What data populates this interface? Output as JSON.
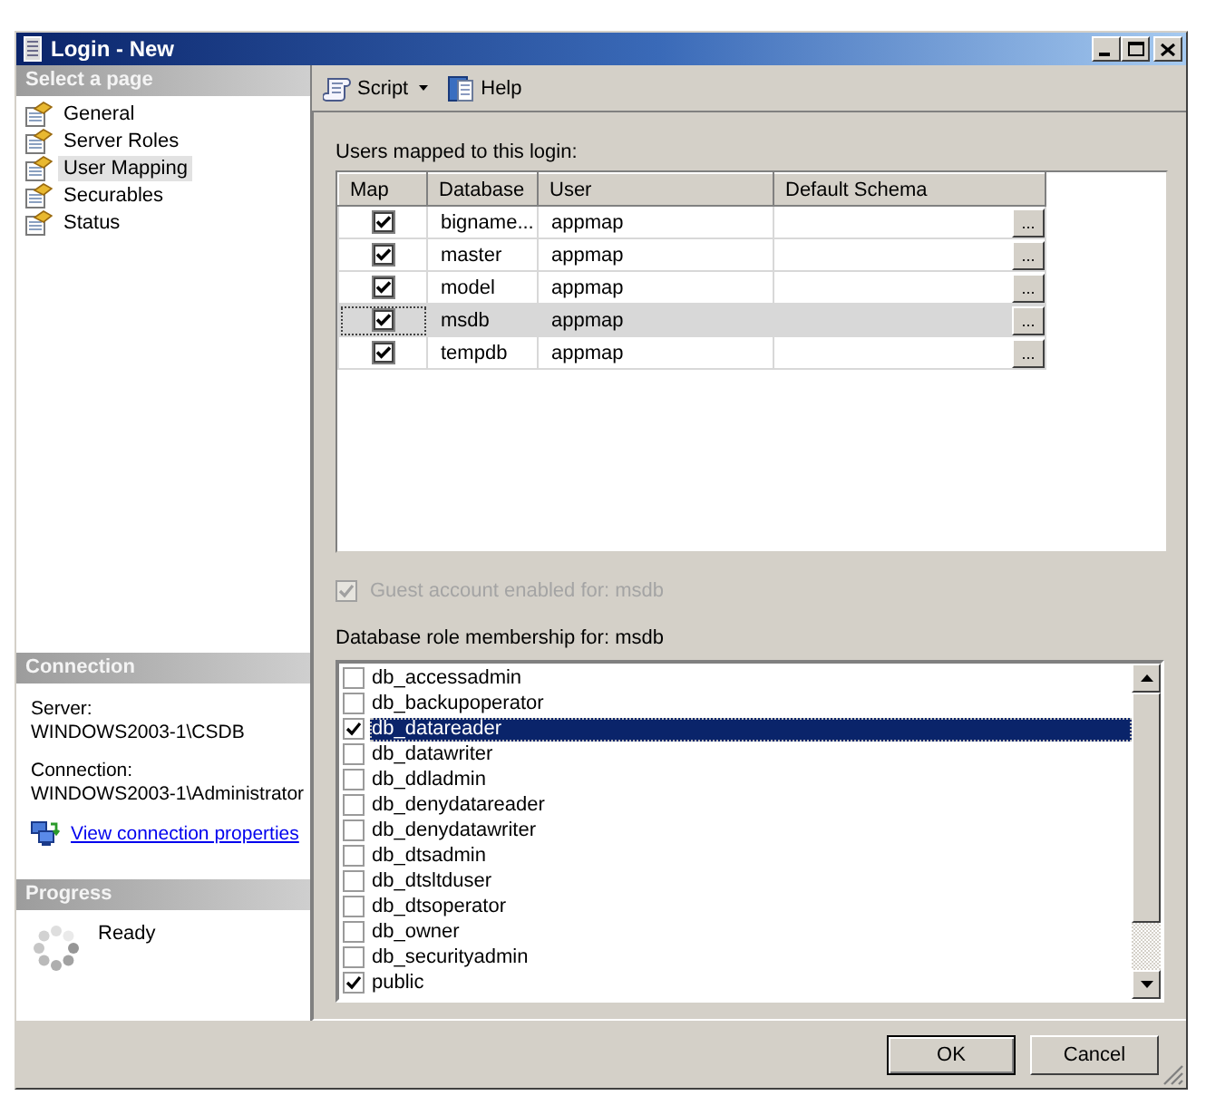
{
  "window": {
    "title": "Login - New"
  },
  "sidebar": {
    "header": "Select a page",
    "items": [
      {
        "label": "General",
        "selected": false
      },
      {
        "label": "Server Roles",
        "selected": false
      },
      {
        "label": "User Mapping",
        "selected": true
      },
      {
        "label": "Securables",
        "selected": false
      },
      {
        "label": "Status",
        "selected": false
      }
    ]
  },
  "connection": {
    "header": "Connection",
    "fields": [
      {
        "label": "Server:",
        "value": "WINDOWS2003-1\\CSDB"
      },
      {
        "label": "Connection:",
        "value": "WINDOWS2003-1\\Administrator"
      }
    ],
    "link": "View connection properties"
  },
  "progress": {
    "header": "Progress",
    "status": "Ready"
  },
  "toolbar": [
    {
      "kind": "script",
      "label": "Script",
      "dropdown": true
    },
    {
      "kind": "help",
      "label": "Help",
      "dropdown": false
    }
  ],
  "user_mapping": {
    "label": "Users mapped to this login:",
    "columns": [
      "Map",
      "Database",
      "User",
      "Default Schema"
    ],
    "rows": [
      {
        "map": true,
        "database": "bigname...",
        "user": "appmap",
        "browse": "...",
        "selected": false
      },
      {
        "map": true,
        "database": "master",
        "user": "appmap",
        "browse": "...",
        "selected": false
      },
      {
        "map": true,
        "database": "model",
        "user": "appmap",
        "browse": "...",
        "selected": false
      },
      {
        "map": true,
        "database": "msdb",
        "user": "appmap",
        "browse": "...",
        "selected": true
      },
      {
        "map": true,
        "database": "tempdb",
        "user": "appmap",
        "browse": "...",
        "selected": false
      }
    ]
  },
  "guest_account": {
    "label": "Guest account enabled for: msdb",
    "checked": true,
    "disabled": true
  },
  "role_membership": {
    "label": "Database role membership for: msdb",
    "roles": [
      {
        "name": "db_accessadmin",
        "checked": false,
        "selected": false
      },
      {
        "name": "db_backupoperator",
        "checked": false,
        "selected": false
      },
      {
        "name": "db_datareader",
        "checked": true,
        "selected": true
      },
      {
        "name": "db_datawriter",
        "checked": false,
        "selected": false
      },
      {
        "name": "db_ddladmin",
        "checked": false,
        "selected": false
      },
      {
        "name": "db_denydatareader",
        "checked": false,
        "selected": false
      },
      {
        "name": "db_denydatawriter",
        "checked": false,
        "selected": false
      },
      {
        "name": "db_dtsadmin",
        "checked": false,
        "selected": false
      },
      {
        "name": "db_dtsltduser",
        "checked": false,
        "selected": false
      },
      {
        "name": "db_dtsoperator",
        "checked": false,
        "selected": false
      },
      {
        "name": "db_owner",
        "checked": false,
        "selected": false
      },
      {
        "name": "db_securityadmin",
        "checked": false,
        "selected": false
      },
      {
        "name": "public",
        "checked": true,
        "selected": false
      }
    ]
  },
  "buttons": [
    {
      "label": "OK",
      "default": true
    },
    {
      "label": "Cancel",
      "default": false
    }
  ]
}
